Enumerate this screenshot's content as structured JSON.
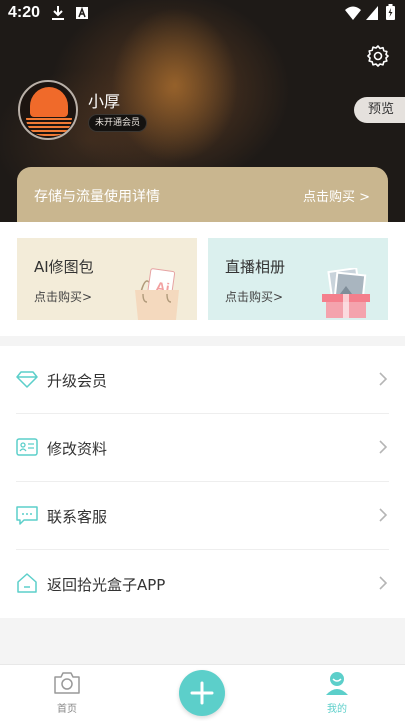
{
  "status_bar": {
    "time": "4:20"
  },
  "profile": {
    "username": "小厚",
    "vip_status": "未开通会员",
    "preview_label": "预览"
  },
  "storage_banner": {
    "title": "存储与流量使用详情",
    "action": "点击购买 >"
  },
  "cards": [
    {
      "title": "AI修图包",
      "subtitle": "点击购买>"
    },
    {
      "title": "直播相册",
      "subtitle": "点击购买>"
    }
  ],
  "menu": [
    {
      "label": "升级会员",
      "icon": "diamond-icon"
    },
    {
      "label": "修改资料",
      "icon": "id-card-icon"
    },
    {
      "label": "联系客服",
      "icon": "chat-icon"
    },
    {
      "label": "返回拾光盒子APP",
      "icon": "home-icon"
    }
  ],
  "tabbar": {
    "home_label": "首页",
    "mine_label": "我的",
    "active_color": "#5ccfca",
    "inactive_color": "#888888"
  }
}
